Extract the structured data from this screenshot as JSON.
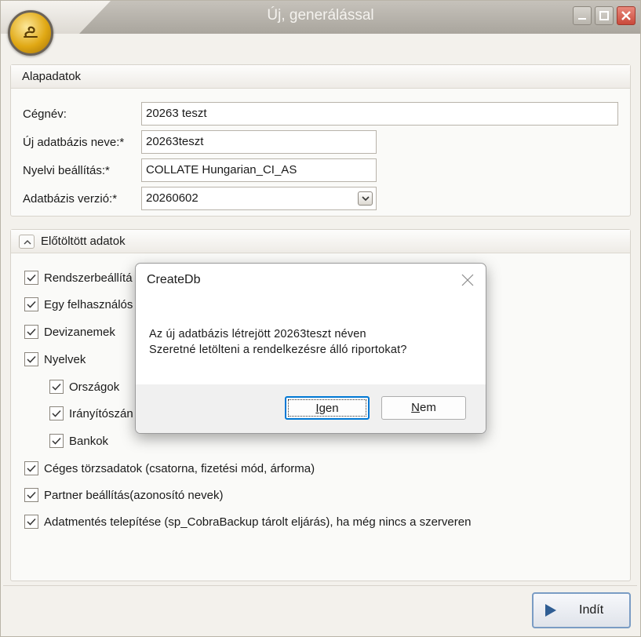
{
  "window": {
    "title": "Új, generálással"
  },
  "basic_group": {
    "header": "Alapadatok",
    "fields": [
      {
        "label": "Cégnév:",
        "value": "20263 teszt"
      },
      {
        "label": "Új adatbázis neve:*",
        "value": "20263teszt"
      },
      {
        "label": "Nyelvi beállítás:*",
        "value": "COLLATE Hungarian_CI_AS"
      },
      {
        "label": "Adatbázis verzió:*",
        "value": "20260602"
      }
    ]
  },
  "preload_group": {
    "header": "Előtöltött adatok",
    "items": [
      {
        "label": "Rendszerbeállítá",
        "checked": true
      },
      {
        "label": "Egy felhasználós",
        "checked": true
      },
      {
        "label": "Devizanemek",
        "checked": true
      },
      {
        "label": "Nyelvek",
        "checked": true
      },
      {
        "label": "Országok",
        "checked": true
      },
      {
        "label": "Irányítószán",
        "checked": true
      },
      {
        "label": "Bankok",
        "checked": true
      },
      {
        "label": "Céges törzsadatok (csatorna, fizetési mód, árforma)",
        "checked": true
      },
      {
        "label": "Partner beállítás(azonosító nevek)",
        "checked": true
      },
      {
        "label": "Adatmentés telepítése (sp_CobraBackup tárolt eljárás), ha még nincs a szerveren",
        "checked": true
      }
    ]
  },
  "start_button": {
    "label": "Indít"
  },
  "dialog": {
    "title": "CreateDb",
    "line1": "Az új adatbázis létrejött 20263teszt néven",
    "line2": "Szeretné letölteni a rendelkezésre álló riportokat?",
    "yes_access": "I",
    "yes_rest": "gen",
    "no_access": "N",
    "no_rest": "em"
  },
  "colors": {
    "accent_focus": "#0078d4",
    "icon_gold": "#e0a814",
    "close_red": "#c9493a"
  },
  "icons": [
    "app-logo-icon",
    "minimize-icon",
    "maximize-icon",
    "close-icon",
    "collapse-arrow-icon",
    "dropdown-arrow-icon",
    "checkbox-check-icon",
    "play-icon"
  ]
}
